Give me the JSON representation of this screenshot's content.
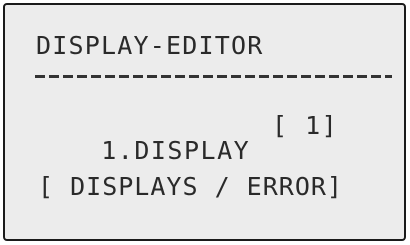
{
  "screen": {
    "title": "DISPLAY-EDITOR",
    "item_label": "1.DISPLAY",
    "item_value": "[ 1]",
    "options_text": "[ DISPLAYS / ERROR]"
  }
}
